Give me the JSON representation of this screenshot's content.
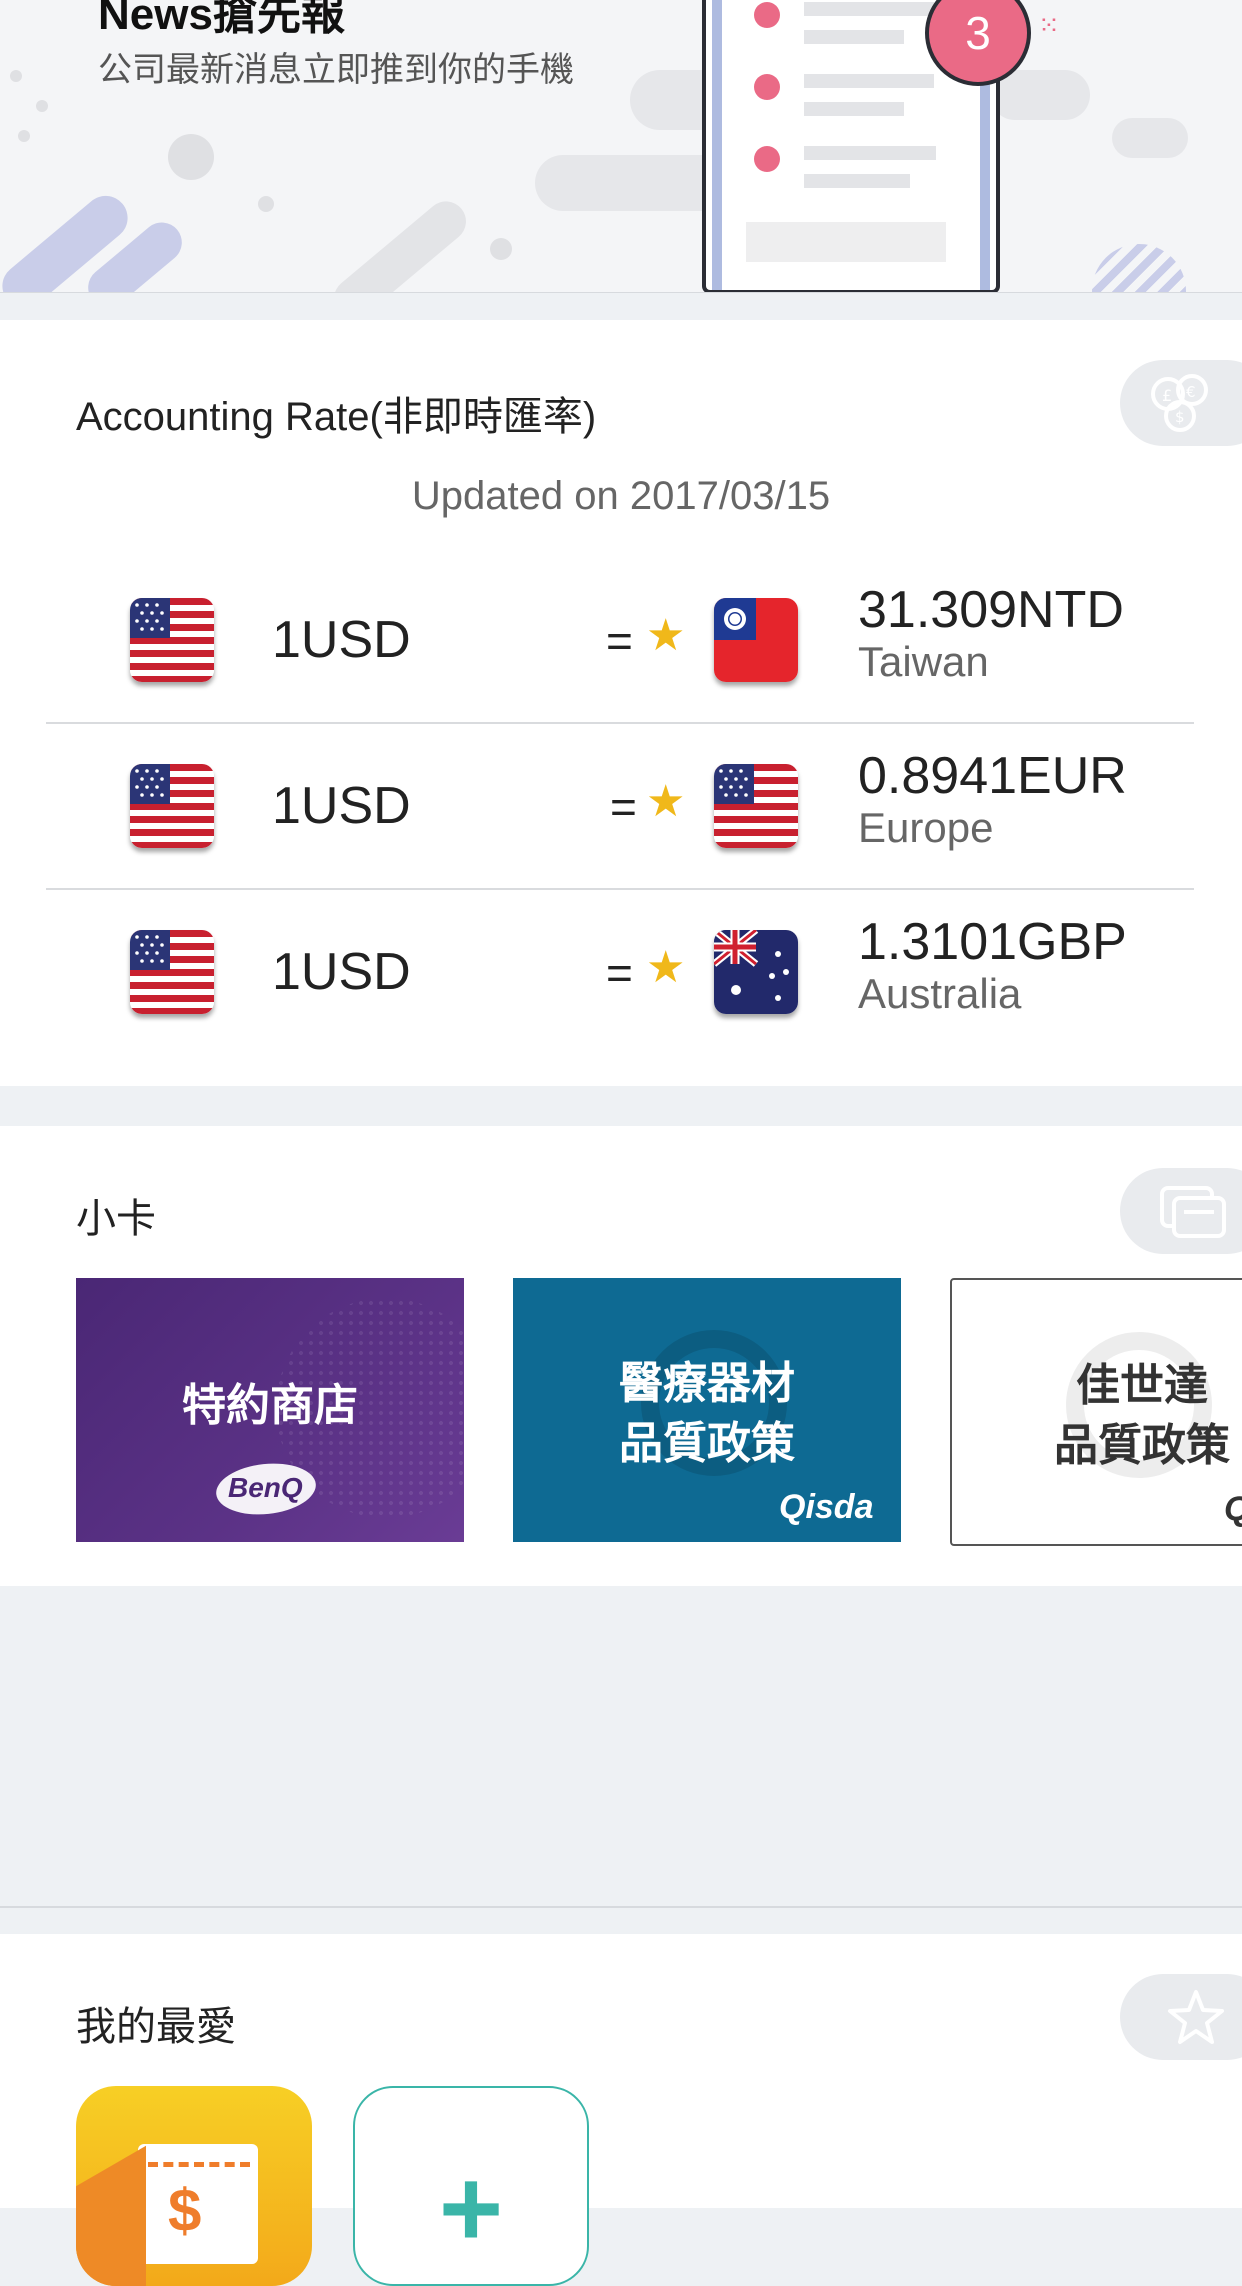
{
  "banner": {
    "title": "News搶先報",
    "subtitle": "公司最新消息立即推到你的手機",
    "badge_count": "3"
  },
  "accounting": {
    "title": "Accounting Rate(非即時匯率)",
    "updated": "Updated on 2017/03/15",
    "side_icon": "currency-exchange-icon",
    "rows": [
      {
        "base": "1USD",
        "equals": "=",
        "value": "31.309NTD",
        "country": "Taiwan",
        "target_flag": "taiwan-flag"
      },
      {
        "base": "1USD",
        "equals": "=",
        "value": "0.8941EUR",
        "country": "Europe",
        "target_flag": "usa-flag"
      },
      {
        "base": "1USD",
        "equals": "=",
        "value": "1.3101GBP",
        "country": "Australia",
        "target_flag": "australia-flag"
      }
    ],
    "star_color": "#f0b81a"
  },
  "cards": {
    "title": "小卡",
    "side_icon": "cards-icon",
    "items": [
      {
        "line1": "特約商店",
        "line2": "",
        "brand": "BenQ",
        "bg": "#4f2a78"
      },
      {
        "line1": "醫療器材",
        "line2": "品質政策",
        "brand": "Qisda",
        "bg": "#0e6a93"
      },
      {
        "line1": "佳世達",
        "line2": "品質政策",
        "brand": "Q",
        "bg": "#ffffff"
      }
    ]
  },
  "favorites": {
    "title": "我的最愛",
    "side_icon": "star-outline-icon",
    "add_symbol": "+"
  },
  "colors": {
    "accent_pink": "#ea6a86",
    "add_teal": "#3ab5a8",
    "fav_yellow": "#f5b81a"
  }
}
